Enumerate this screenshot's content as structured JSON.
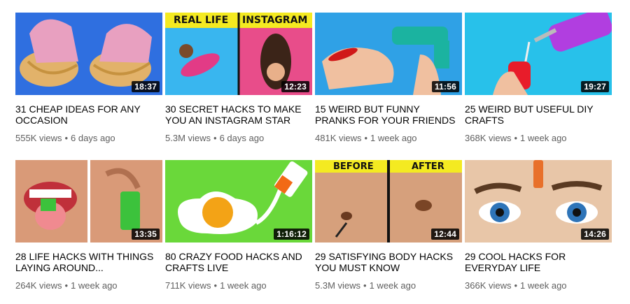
{
  "videos": [
    {
      "title": "31 CHEAP IDEAS FOR ANY OCCASION",
      "views": "555K views",
      "age": "6 days ago",
      "duration": "18:37"
    },
    {
      "title": "30 SECRET HACKS TO MAKE YOU AN INSTAGRAM STAR",
      "views": "5.3M views",
      "age": "6 days ago",
      "duration": "12:23",
      "banner_left": "REAL LIFE",
      "banner_right": "INSTAGRAM"
    },
    {
      "title": "15 WEIRD BUT FUNNY PRANKS FOR YOUR FRIENDS",
      "views": "481K views",
      "age": "1 week ago",
      "duration": "11:56"
    },
    {
      "title": "25 WEIRD BUT USEFUL DIY CRAFTS",
      "views": "368K views",
      "age": "1 week ago",
      "duration": "19:27"
    },
    {
      "title": "28 LIFE HACKS WITH THINGS LAYING AROUND...",
      "views": "264K views",
      "age": "1 week ago",
      "duration": "13:35"
    },
    {
      "title": "80 CRAZY FOOD HACKS AND CRAFTS LIVE",
      "views": "711K views",
      "age": "1 week ago",
      "duration": "1:16:12"
    },
    {
      "title": "29 SATISFYING BODY HACKS YOU MUST KNOW",
      "views": "5.3M views",
      "age": "1 week ago",
      "duration": "12:44",
      "banner_left": "BEFORE",
      "banner_right": "AFTER"
    },
    {
      "title": "29 COOL HACKS FOR EVERYDAY LIFE",
      "views": "366K views",
      "age": "1 week ago",
      "duration": "14:26"
    }
  ],
  "separator": "•"
}
